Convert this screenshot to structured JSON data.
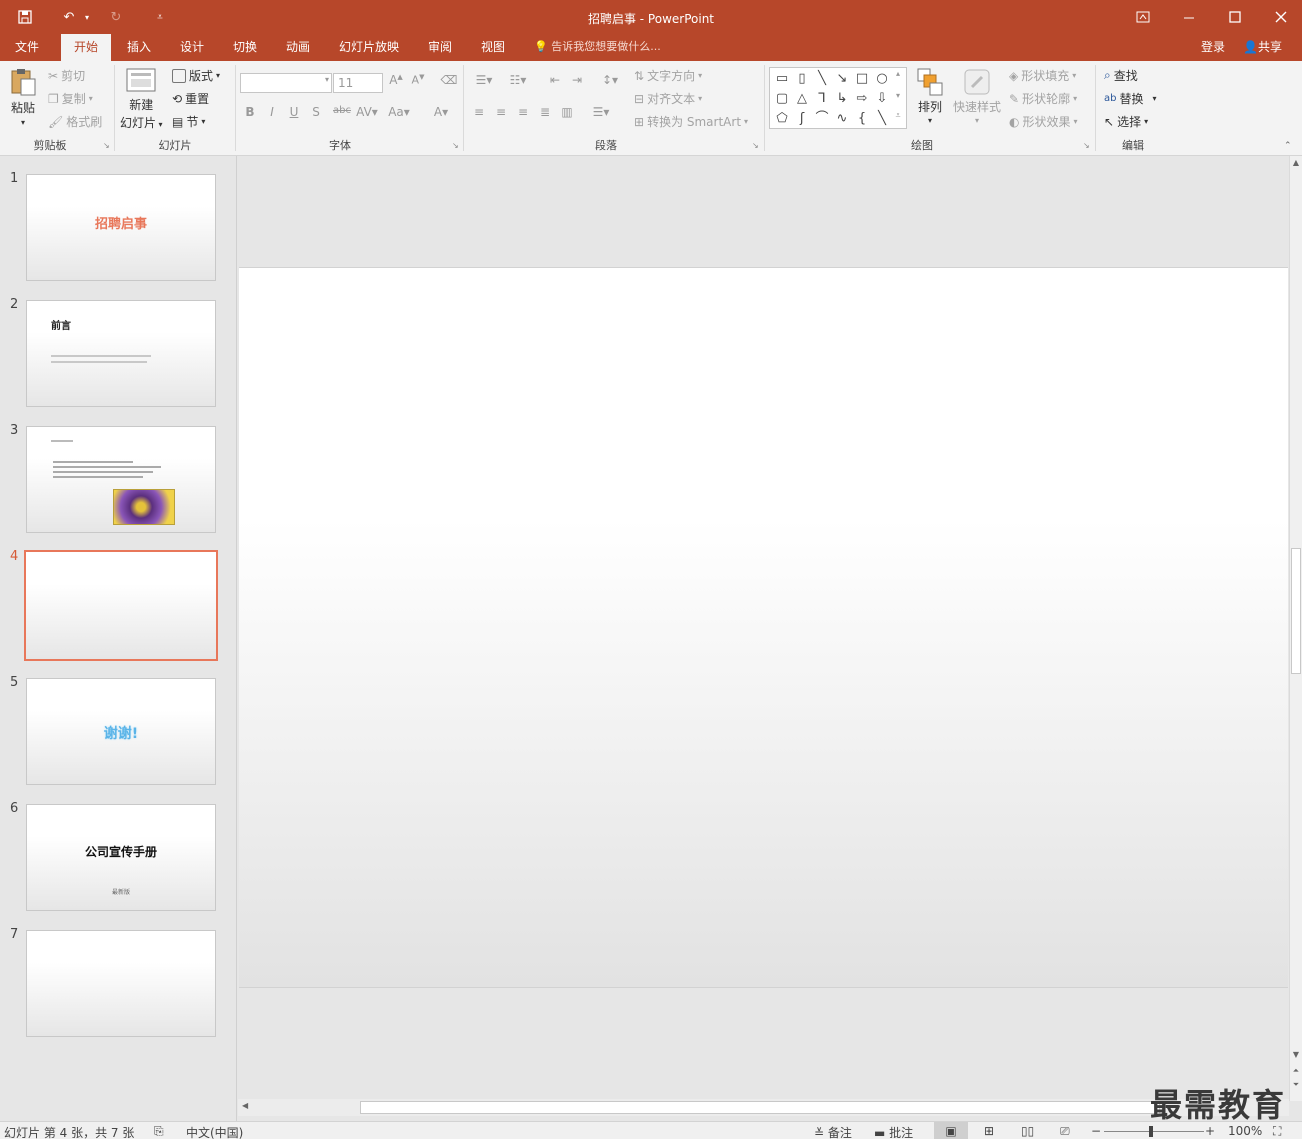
{
  "window": {
    "title": "招聘启事 - PowerPoint"
  },
  "tabs": [
    "文件",
    "开始",
    "插入",
    "设计",
    "切换",
    "动画",
    "幻灯片放映",
    "审阅",
    "视图"
  ],
  "tell_me": "告诉我您想要做什么...",
  "account": {
    "login": "登录",
    "share": "共享"
  },
  "ribbon": {
    "clipboard": {
      "paste": "粘贴",
      "cut": "剪切",
      "copy": "复制",
      "format_painter": "格式刷",
      "label": "剪贴板"
    },
    "slides": {
      "new_slide_1": "新建",
      "new_slide_2": "幻灯片",
      "layout": "版式",
      "reset": "重置",
      "section": "节",
      "label": "幻灯片"
    },
    "font": {
      "size": "11",
      "label": "字体"
    },
    "paragraph": {
      "text_direction": "文字方向",
      "align_text": "对齐文本",
      "smartart": "转换为 SmartArt",
      "label": "段落"
    },
    "drawing": {
      "arrange": "排列",
      "quick_styles": "快速样式",
      "shape_fill": "形状填充",
      "shape_outline": "形状轮廓",
      "shape_effects": "形状效果",
      "label": "绘图"
    },
    "editing": {
      "find": "查找",
      "replace": "替换",
      "select": "选择",
      "label": "编辑"
    }
  },
  "slides": [
    {
      "num": "1",
      "title": "招聘启事"
    },
    {
      "num": "2",
      "title": "前言"
    },
    {
      "num": "3",
      "title": ""
    },
    {
      "num": "4",
      "title": ""
    },
    {
      "num": "5",
      "title": "谢谢!"
    },
    {
      "num": "6",
      "title": "公司宣传手册",
      "subtitle": "最新版"
    },
    {
      "num": "7",
      "title": ""
    }
  ],
  "current_slide": 4,
  "status": {
    "slide_info": "幻灯片 第 4 张，共 7 张",
    "language": "中文(中国)",
    "notes": "备注",
    "comments": "批注",
    "zoom": "100%"
  },
  "watermark": "最需教育",
  "colors": {
    "accent": "#b7472a",
    "selection": "#e8775a"
  }
}
